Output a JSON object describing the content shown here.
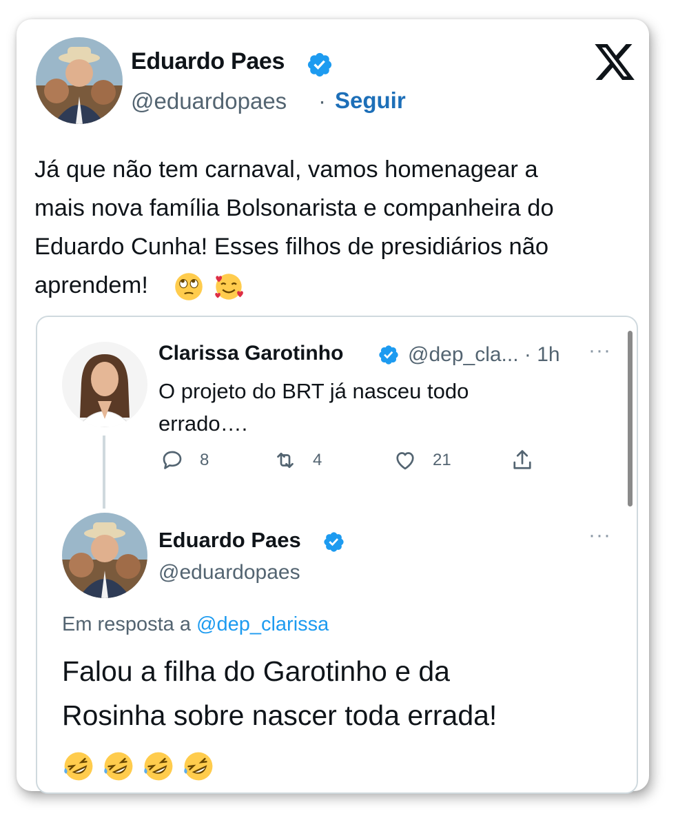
{
  "main": {
    "author_name": "Eduardo Paes",
    "handle": "@eduardopaes",
    "separator": "·",
    "follow_label": "Seguir",
    "text_lines": [
      "Já que não tem carnaval, vamos homenagear a",
      "mais nova família Bolsonarista e companheira do",
      "Eduardo Cunha!  Esses filhos de presidiários não",
      "aprendem!"
    ],
    "emojis": [
      "face-with-rolling-eyes-emoji",
      "smiling-face-with-hearts-emoji"
    ]
  },
  "quote": {
    "first": {
      "author_name": "Clarissa Garotinho",
      "handle_time": "@dep_cla... · 1h",
      "more": "···",
      "text_lines": [
        "O projeto do BRT já nasceu todo",
        "errado…."
      ],
      "reply_count": "8",
      "retweet_count": "4",
      "like_count": "21"
    },
    "second": {
      "author_name": "Eduardo Paes",
      "handle": "@eduardopaes",
      "more": "···",
      "reply_prefix": "Em resposta a ",
      "reply_mention": "@dep_clarissa",
      "text_lines": [
        "Falou a filha do Garotinho e da",
        "Rosinha sobre nascer toda errada!"
      ],
      "emojis": [
        "rofl-emoji",
        "rofl-emoji",
        "rofl-emoji",
        "rofl-emoji"
      ]
    }
  },
  "colors": {
    "verified": "#1d9bf0",
    "follow": "#1d6fb8",
    "text": "#0f1419",
    "muted": "#536471"
  }
}
